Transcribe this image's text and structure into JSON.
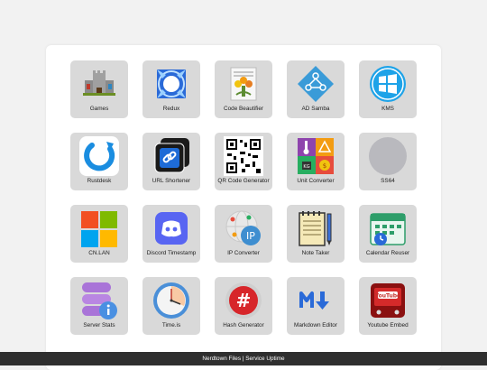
{
  "tiles": [
    {
      "label": "Games",
      "icon": "castle-icon"
    },
    {
      "label": "Redux",
      "icon": "redux-arrows-icon"
    },
    {
      "label": "Code Beautifier",
      "icon": "code-beautifier-icon"
    },
    {
      "label": "AD Samba",
      "icon": "ad-samba-icon"
    },
    {
      "label": "KMS",
      "icon": "windows-logo-icon"
    },
    {
      "label": "Rustdesk",
      "icon": "rustdesk-icon"
    },
    {
      "label": "URL Shortener",
      "icon": "link-icon"
    },
    {
      "label": "QR Code Generator",
      "icon": "qr-code-icon"
    },
    {
      "label": "Unit Converter",
      "icon": "unit-converter-icon"
    },
    {
      "label": "SS64",
      "icon": "gray-circle-icon"
    },
    {
      "label": "CN.LAN",
      "icon": "four-squares-icon"
    },
    {
      "label": "Discord Timestamp",
      "icon": "discord-icon"
    },
    {
      "label": "IP Converter",
      "icon": "ip-globe-icon"
    },
    {
      "label": "Note Taker",
      "icon": "notepad-icon"
    },
    {
      "label": "Calendar Reuser",
      "icon": "calendar-icon"
    },
    {
      "label": "Server Stats",
      "icon": "server-stats-icon"
    },
    {
      "label": "Time.is",
      "icon": "clock-icon"
    },
    {
      "label": "Hash Generator",
      "icon": "hash-icon"
    },
    {
      "label": "Markdown Editor",
      "icon": "markdown-icon"
    },
    {
      "label": "Youtube Embed",
      "icon": "youtube-tv-icon"
    }
  ],
  "footer": {
    "link1": "Nerdtown Files",
    "separator": " | ",
    "link2": "Service Uptime"
  }
}
